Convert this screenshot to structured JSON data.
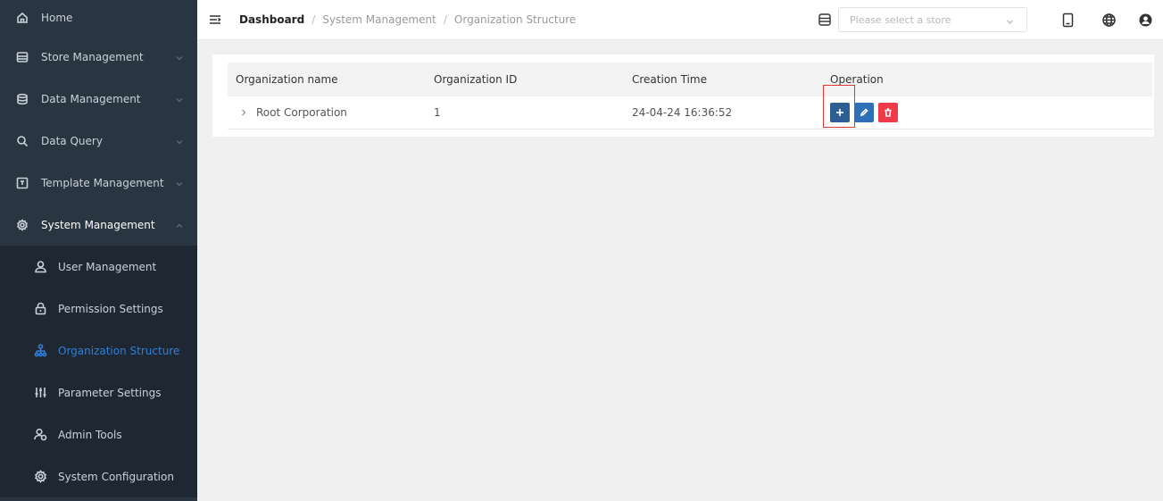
{
  "sidebar": {
    "items": [
      {
        "label": "Home",
        "icon": "home-icon"
      },
      {
        "label": "Store Management",
        "icon": "store-icon",
        "expanded": false
      },
      {
        "label": "Data Management",
        "icon": "database-icon",
        "expanded": false
      },
      {
        "label": "Data Query",
        "icon": "search-icon",
        "expanded": false
      },
      {
        "label": "Template Management",
        "icon": "template-icon",
        "expanded": false
      },
      {
        "label": "System Management",
        "icon": "gear-icon",
        "expanded": true
      }
    ],
    "submenu": [
      {
        "label": "User Management",
        "icon": "user-icon"
      },
      {
        "label": "Permission Settings",
        "icon": "lock-icon"
      },
      {
        "label": "Organization Structure",
        "icon": "org-chart-icon",
        "active": true
      },
      {
        "label": "Parameter Settings",
        "icon": "sliders-icon"
      },
      {
        "label": "Admin Tools",
        "icon": "admin-user-icon"
      },
      {
        "label": "System Configuration",
        "icon": "settings-config-icon"
      }
    ],
    "colors": {
      "background": "#2a3542",
      "submenu_background": "#1f2832",
      "active": "#2f7fd8"
    }
  },
  "header": {
    "breadcrumb": [
      "Dashboard",
      "System Management",
      "Organization Structure"
    ],
    "breadcrumb_separator": "/",
    "store_select": {
      "placeholder": "Please select a store"
    },
    "icons": [
      "store-icon",
      "tablet-icon",
      "globe-icon",
      "user-avatar-icon"
    ]
  },
  "table": {
    "columns": [
      "Organization name",
      "Organization ID",
      "Creation Time",
      "Operation"
    ],
    "rows": [
      {
        "name": "Root Corporation",
        "id": "1",
        "created": "24-04-24 16:36:52"
      }
    ],
    "operations": [
      {
        "icon": "plus-icon",
        "color": "#2d5f93"
      },
      {
        "icon": "edit-icon",
        "color": "#2f6fb8"
      },
      {
        "icon": "trash-icon",
        "color": "#ef3b49"
      }
    ],
    "highlight_color": "#e23535"
  }
}
